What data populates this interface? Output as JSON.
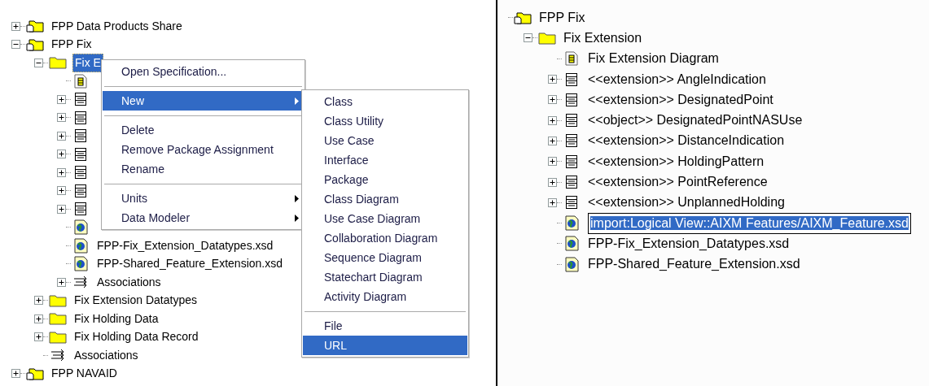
{
  "left_tree": [
    {
      "kind": "package-root",
      "label": "FPP Data Products Share",
      "expanded": false,
      "selected": false
    },
    {
      "kind": "package-root",
      "label": "FPP Fix",
      "expanded": true,
      "selected": false,
      "children": [
        {
          "kind": "folder",
          "label": "Fix E",
          "expanded": true,
          "selected": true,
          "children": [
            {
              "kind": "diagram",
              "selected": false
            },
            {
              "kind": "class",
              "expanded": false,
              "selected": false
            },
            {
              "kind": "class",
              "expanded": false,
              "selected": false
            },
            {
              "kind": "class",
              "expanded": false,
              "selected": false
            },
            {
              "kind": "class",
              "expanded": false,
              "selected": false
            },
            {
              "kind": "class",
              "expanded": false,
              "selected": false
            },
            {
              "kind": "class",
              "expanded": false,
              "selected": false
            },
            {
              "kind": "class",
              "expanded": false,
              "selected": false
            },
            {
              "kind": "xsd",
              "selected": false
            },
            {
              "kind": "xsd",
              "label": "FPP-Fix_Extension_Datatypes.xsd",
              "selected": false
            },
            {
              "kind": "xsd",
              "label": "FPP-Shared_Feature_Extension.xsd",
              "selected": false
            },
            {
              "kind": "associations",
              "label": "Associations",
              "expanded": false,
              "selected": false
            }
          ]
        },
        {
          "kind": "folder",
          "label": "Fix Extension Datatypes",
          "expanded": false,
          "selected": false
        },
        {
          "kind": "folder",
          "label": "Fix Holding Data",
          "expanded": false,
          "selected": false
        },
        {
          "kind": "folder",
          "label": "Fix Holding Data Record",
          "expanded": false,
          "selected": false
        },
        {
          "kind": "associations",
          "label": "Associations",
          "selected": false
        }
      ]
    },
    {
      "kind": "package-root",
      "label": "FPP NAVAID",
      "expanded": false,
      "selected": false
    }
  ],
  "context_menu": [
    {
      "kind": "item",
      "label": "Open Specification...",
      "selected": false
    },
    {
      "kind": "separator"
    },
    {
      "kind": "item",
      "label": "New",
      "submenu": true,
      "selected": true
    },
    {
      "kind": "separator"
    },
    {
      "kind": "item",
      "label": "Delete",
      "selected": false
    },
    {
      "kind": "item",
      "label": "Remove Package Assignment",
      "selected": false
    },
    {
      "kind": "item",
      "label": "Rename",
      "selected": false
    },
    {
      "kind": "separator"
    },
    {
      "kind": "item",
      "label": "Units",
      "submenu": true,
      "selected": false
    },
    {
      "kind": "item",
      "label": "Data Modeler",
      "submenu": true,
      "selected": false
    }
  ],
  "new_submenu": [
    {
      "kind": "item",
      "label": "Class",
      "selected": false
    },
    {
      "kind": "item",
      "label": "Class Utility",
      "selected": false
    },
    {
      "kind": "item",
      "label": "Use Case",
      "selected": false
    },
    {
      "kind": "item",
      "label": "Interface",
      "selected": false
    },
    {
      "kind": "item",
      "label": "Package",
      "selected": false
    },
    {
      "kind": "item",
      "label": "Class Diagram",
      "selected": false
    },
    {
      "kind": "item",
      "label": "Use Case Diagram",
      "selected": false
    },
    {
      "kind": "item",
      "label": "Collaboration Diagram",
      "selected": false
    },
    {
      "kind": "item",
      "label": "Sequence Diagram",
      "selected": false
    },
    {
      "kind": "item",
      "label": "Statechart Diagram",
      "selected": false
    },
    {
      "kind": "item",
      "label": "Activity Diagram",
      "selected": false
    },
    {
      "kind": "separator"
    },
    {
      "kind": "item",
      "label": "File",
      "selected": false
    },
    {
      "kind": "item",
      "label": "URL",
      "selected": true
    }
  ],
  "right_tree": [
    {
      "kind": "package-root",
      "label": "FPP Fix",
      "selected": false,
      "editing": false,
      "children": [
        {
          "kind": "folder",
          "label": "Fix Extension",
          "expanded": true,
          "selected": false,
          "editing": false,
          "children": [
            {
              "kind": "diagram",
              "label": "Fix Extension Diagram",
              "selected": false,
              "editing": false
            },
            {
              "kind": "class",
              "label": "<<extension>> AngleIndication",
              "expanded": false,
              "selected": false,
              "editing": false
            },
            {
              "kind": "class",
              "label": "<<extension>> DesignatedPoint",
              "expanded": false,
              "selected": false,
              "editing": false
            },
            {
              "kind": "class",
              "label": "<<object>> DesignatedPointNASUse",
              "expanded": false,
              "selected": false,
              "editing": false
            },
            {
              "kind": "class",
              "label": "<<extension>> DistanceIndication",
              "expanded": false,
              "selected": false,
              "editing": false
            },
            {
              "kind": "class",
              "label": "<<extension>> HoldingPattern",
              "expanded": false,
              "selected": false,
              "editing": false
            },
            {
              "kind": "class",
              "label": "<<extension>> PointReference",
              "expanded": false,
              "selected": false,
              "editing": false
            },
            {
              "kind": "class",
              "label": "<<extension>> UnplannedHolding",
              "expanded": false,
              "selected": false,
              "editing": false
            },
            {
              "kind": "xsd",
              "label": "import:Logical View::AIXM Features/AIXM_Feature.xsd",
              "selected": true,
              "editing": true
            },
            {
              "kind": "xsd",
              "label": "FPP-Fix_Extension_Datatypes.xsd",
              "selected": false,
              "editing": false
            },
            {
              "kind": "xsd",
              "label": "FPP-Shared_Feature_Extension.xsd",
              "selected": false,
              "editing": false
            }
          ]
        }
      ]
    }
  ]
}
